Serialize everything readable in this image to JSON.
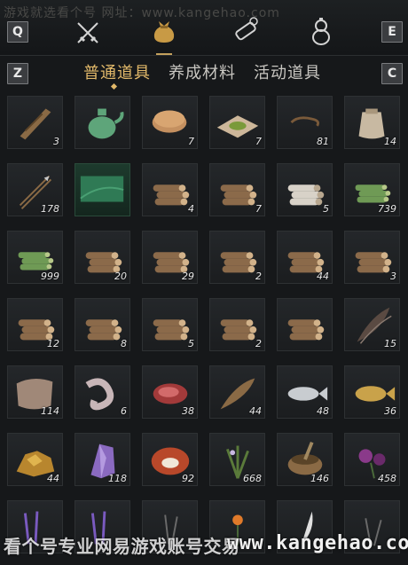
{
  "watermark_top": "游戏就选看个号  网址：www.kangehao.com",
  "keys": {
    "q": "Q",
    "e": "E",
    "z": "Z",
    "c": "C"
  },
  "top_tabs": [
    {
      "icon": "crossed-swords-icon"
    },
    {
      "icon": "money-bag-icon",
      "active": true
    },
    {
      "icon": "scroll-icon"
    },
    {
      "icon": "gourd-icon"
    }
  ],
  "category_tabs": [
    {
      "label": "普通道具",
      "active": true
    },
    {
      "label": "养成材料"
    },
    {
      "label": "活动道具"
    }
  ],
  "items": [
    {
      "icon": "wooden-frame-icon",
      "qty": "3"
    },
    {
      "icon": "jade-teapot-icon",
      "qty": ""
    },
    {
      "icon": "flatbread-icon",
      "qty": "7"
    },
    {
      "icon": "herb-powder-icon",
      "qty": "7"
    },
    {
      "icon": "hook-icon",
      "qty": "81"
    },
    {
      "icon": "cloth-sack-icon",
      "qty": "14"
    },
    {
      "icon": "arrow-icon",
      "qty": "178"
    },
    {
      "icon": "green-scroll-icon",
      "qty": ""
    },
    {
      "icon": "log-bundle-icon",
      "qty": "4"
    },
    {
      "icon": "log-bundle-icon",
      "qty": "7"
    },
    {
      "icon": "birch-log-icon",
      "qty": "5"
    },
    {
      "icon": "bamboo-bundle-icon",
      "qty": "739"
    },
    {
      "icon": "bamboo-bundle-icon",
      "qty": "999"
    },
    {
      "icon": "log-bundle-icon",
      "qty": "20"
    },
    {
      "icon": "log-bundle-icon",
      "qty": "29"
    },
    {
      "icon": "log-bundle-icon",
      "qty": "2"
    },
    {
      "icon": "log-bundle-icon",
      "qty": "44"
    },
    {
      "icon": "log-bundle-icon",
      "qty": "3"
    },
    {
      "icon": "log-bundle-icon",
      "qty": "12"
    },
    {
      "icon": "log-bundle-icon",
      "qty": "8"
    },
    {
      "icon": "log-bundle-icon",
      "qty": "5"
    },
    {
      "icon": "log-bundle-icon",
      "qty": "2"
    },
    {
      "icon": "log-bundle-icon",
      "qty": ""
    },
    {
      "icon": "feather-icon",
      "qty": "15"
    },
    {
      "icon": "fur-pelt-icon",
      "qty": "114"
    },
    {
      "icon": "intestine-icon",
      "qty": "6"
    },
    {
      "icon": "raw-meat-icon",
      "qty": "38"
    },
    {
      "icon": "catfish-icon",
      "qty": "44"
    },
    {
      "icon": "silver-fish-icon",
      "qty": "48"
    },
    {
      "icon": "carp-icon",
      "qty": "36"
    },
    {
      "icon": "gold-ore-icon",
      "qty": "44"
    },
    {
      "icon": "amethyst-icon",
      "qty": "118"
    },
    {
      "icon": "red-stone-icon",
      "qty": "92"
    },
    {
      "icon": "herb-plant-icon",
      "qty": "668"
    },
    {
      "icon": "mortar-herbs-icon",
      "qty": "146"
    },
    {
      "icon": "purple-flower-icon",
      "qty": "458"
    },
    {
      "icon": "lavender-icon",
      "qty": ""
    },
    {
      "icon": "lavender-icon",
      "qty": ""
    },
    {
      "icon": "dark-herb-icon",
      "qty": ""
    },
    {
      "icon": "orange-flower-icon",
      "qty": ""
    },
    {
      "icon": "white-feather-icon",
      "qty": ""
    },
    {
      "icon": "grass-icon",
      "qty": ""
    }
  ],
  "bottom_watermark": {
    "text": "看个号专业网易游戏账号交易",
    "url": "www.kangehao.co"
  },
  "colors": {
    "accent": "#e2b96a",
    "background": "#16181a"
  }
}
